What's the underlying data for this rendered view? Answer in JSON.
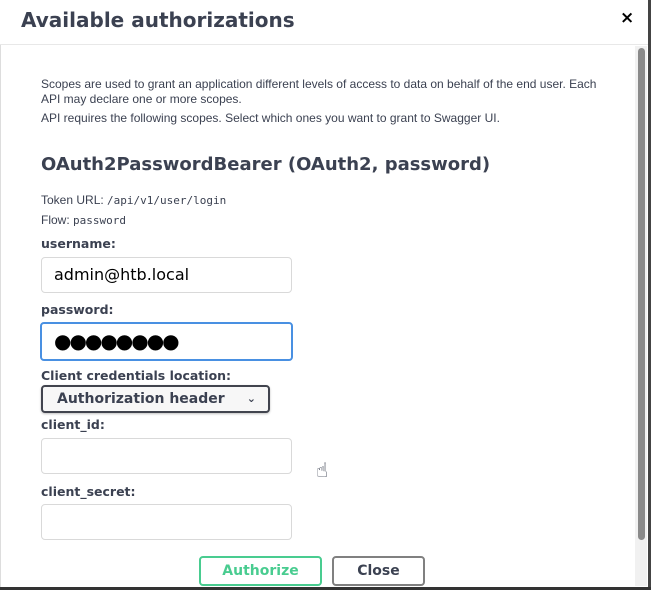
{
  "dialog": {
    "title": "Available authorizations",
    "close_icon": "×"
  },
  "description": {
    "line1": "Scopes are used to grant an application different levels of access to data on behalf of the end user. Each API may declare one or more scopes.",
    "line2": "API requires the following scopes. Select which ones you want to grant to Swagger UI."
  },
  "scheme": {
    "title": "OAuth2PasswordBearer (OAuth2, password)",
    "token_url_label": "Token URL:",
    "token_url": "/api/v1/user/login",
    "flow_label": "Flow:",
    "flow": "password"
  },
  "form": {
    "username_label": "username:",
    "username_value": "admin@htb.local",
    "password_label": "password:",
    "password_value": "●●●●●●●●",
    "client_location_label": "Client credentials location:",
    "client_location_value": "Authorization header",
    "client_id_label": "client_id:",
    "client_id_value": "",
    "client_secret_label": "client_secret:",
    "client_secret_value": ""
  },
  "buttons": {
    "authorize": "Authorize",
    "close": "Close"
  },
  "colors": {
    "authorize": "#49cc90",
    "focus": "#4990e2",
    "text": "#3b4151"
  }
}
